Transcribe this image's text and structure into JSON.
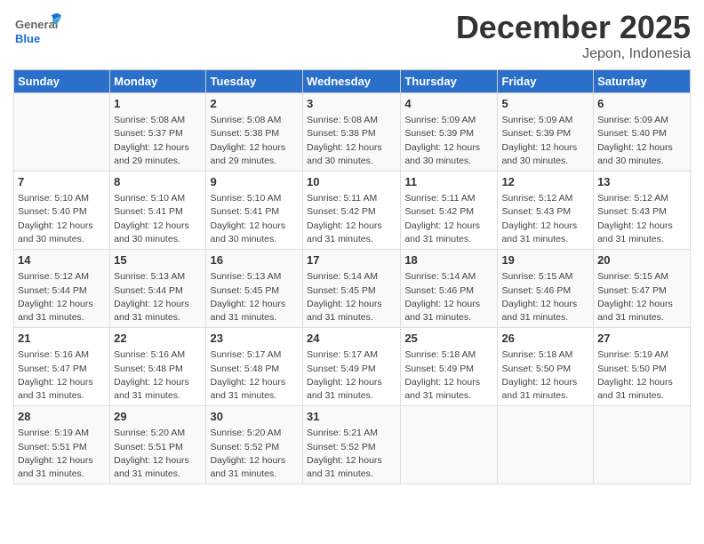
{
  "header": {
    "logo_general": "General",
    "logo_blue": "Blue",
    "month_title": "December 2025",
    "location": "Jepon, Indonesia"
  },
  "days_of_week": [
    "Sunday",
    "Monday",
    "Tuesday",
    "Wednesday",
    "Thursday",
    "Friday",
    "Saturday"
  ],
  "weeks": [
    [
      {
        "day": "",
        "info": ""
      },
      {
        "day": "1",
        "info": "Sunrise: 5:08 AM\nSunset: 5:37 PM\nDaylight: 12 hours\nand 29 minutes."
      },
      {
        "day": "2",
        "info": "Sunrise: 5:08 AM\nSunset: 5:38 PM\nDaylight: 12 hours\nand 29 minutes."
      },
      {
        "day": "3",
        "info": "Sunrise: 5:08 AM\nSunset: 5:38 PM\nDaylight: 12 hours\nand 30 minutes."
      },
      {
        "day": "4",
        "info": "Sunrise: 5:09 AM\nSunset: 5:39 PM\nDaylight: 12 hours\nand 30 minutes."
      },
      {
        "day": "5",
        "info": "Sunrise: 5:09 AM\nSunset: 5:39 PM\nDaylight: 12 hours\nand 30 minutes."
      },
      {
        "day": "6",
        "info": "Sunrise: 5:09 AM\nSunset: 5:40 PM\nDaylight: 12 hours\nand 30 minutes."
      }
    ],
    [
      {
        "day": "7",
        "info": "Sunrise: 5:10 AM\nSunset: 5:40 PM\nDaylight: 12 hours\nand 30 minutes."
      },
      {
        "day": "8",
        "info": "Sunrise: 5:10 AM\nSunset: 5:41 PM\nDaylight: 12 hours\nand 30 minutes."
      },
      {
        "day": "9",
        "info": "Sunrise: 5:10 AM\nSunset: 5:41 PM\nDaylight: 12 hours\nand 30 minutes."
      },
      {
        "day": "10",
        "info": "Sunrise: 5:11 AM\nSunset: 5:42 PM\nDaylight: 12 hours\nand 31 minutes."
      },
      {
        "day": "11",
        "info": "Sunrise: 5:11 AM\nSunset: 5:42 PM\nDaylight: 12 hours\nand 31 minutes."
      },
      {
        "day": "12",
        "info": "Sunrise: 5:12 AM\nSunset: 5:43 PM\nDaylight: 12 hours\nand 31 minutes."
      },
      {
        "day": "13",
        "info": "Sunrise: 5:12 AM\nSunset: 5:43 PM\nDaylight: 12 hours\nand 31 minutes."
      }
    ],
    [
      {
        "day": "14",
        "info": "Sunrise: 5:12 AM\nSunset: 5:44 PM\nDaylight: 12 hours\nand 31 minutes."
      },
      {
        "day": "15",
        "info": "Sunrise: 5:13 AM\nSunset: 5:44 PM\nDaylight: 12 hours\nand 31 minutes."
      },
      {
        "day": "16",
        "info": "Sunrise: 5:13 AM\nSunset: 5:45 PM\nDaylight: 12 hours\nand 31 minutes."
      },
      {
        "day": "17",
        "info": "Sunrise: 5:14 AM\nSunset: 5:45 PM\nDaylight: 12 hours\nand 31 minutes."
      },
      {
        "day": "18",
        "info": "Sunrise: 5:14 AM\nSunset: 5:46 PM\nDaylight: 12 hours\nand 31 minutes."
      },
      {
        "day": "19",
        "info": "Sunrise: 5:15 AM\nSunset: 5:46 PM\nDaylight: 12 hours\nand 31 minutes."
      },
      {
        "day": "20",
        "info": "Sunrise: 5:15 AM\nSunset: 5:47 PM\nDaylight: 12 hours\nand 31 minutes."
      }
    ],
    [
      {
        "day": "21",
        "info": "Sunrise: 5:16 AM\nSunset: 5:47 PM\nDaylight: 12 hours\nand 31 minutes."
      },
      {
        "day": "22",
        "info": "Sunrise: 5:16 AM\nSunset: 5:48 PM\nDaylight: 12 hours\nand 31 minutes."
      },
      {
        "day": "23",
        "info": "Sunrise: 5:17 AM\nSunset: 5:48 PM\nDaylight: 12 hours\nand 31 minutes."
      },
      {
        "day": "24",
        "info": "Sunrise: 5:17 AM\nSunset: 5:49 PM\nDaylight: 12 hours\nand 31 minutes."
      },
      {
        "day": "25",
        "info": "Sunrise: 5:18 AM\nSunset: 5:49 PM\nDaylight: 12 hours\nand 31 minutes."
      },
      {
        "day": "26",
        "info": "Sunrise: 5:18 AM\nSunset: 5:50 PM\nDaylight: 12 hours\nand 31 minutes."
      },
      {
        "day": "27",
        "info": "Sunrise: 5:19 AM\nSunset: 5:50 PM\nDaylight: 12 hours\nand 31 minutes."
      }
    ],
    [
      {
        "day": "28",
        "info": "Sunrise: 5:19 AM\nSunset: 5:51 PM\nDaylight: 12 hours\nand 31 minutes."
      },
      {
        "day": "29",
        "info": "Sunrise: 5:20 AM\nSunset: 5:51 PM\nDaylight: 12 hours\nand 31 minutes."
      },
      {
        "day": "30",
        "info": "Sunrise: 5:20 AM\nSunset: 5:52 PM\nDaylight: 12 hours\nand 31 minutes."
      },
      {
        "day": "31",
        "info": "Sunrise: 5:21 AM\nSunset: 5:52 PM\nDaylight: 12 hours\nand 31 minutes."
      },
      {
        "day": "",
        "info": ""
      },
      {
        "day": "",
        "info": ""
      },
      {
        "day": "",
        "info": ""
      }
    ]
  ]
}
